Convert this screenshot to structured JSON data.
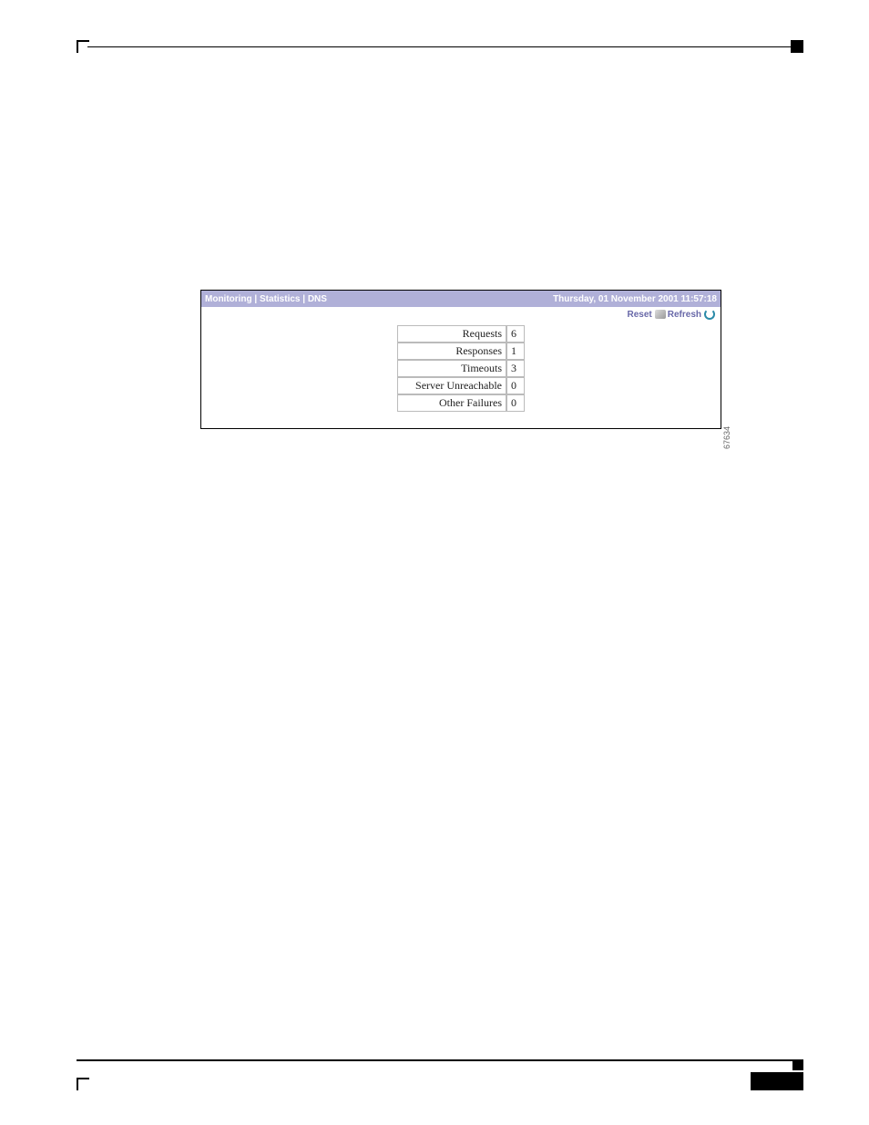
{
  "breadcrumb": "Monitoring | Statistics | DNS",
  "timestamp": "Thursday, 01 November 2001 11:57:18",
  "toolbar": {
    "reset_label": "Reset",
    "refresh_label": "Refresh"
  },
  "stats": {
    "rows": [
      {
        "label": "Requests",
        "value": "6"
      },
      {
        "label": "Responses",
        "value": "1"
      },
      {
        "label": "Timeouts",
        "value": "3"
      },
      {
        "label": "Server Unreachable",
        "value": "0"
      },
      {
        "label": "Other Failures",
        "value": "0"
      }
    ]
  },
  "figure_id": "67634"
}
